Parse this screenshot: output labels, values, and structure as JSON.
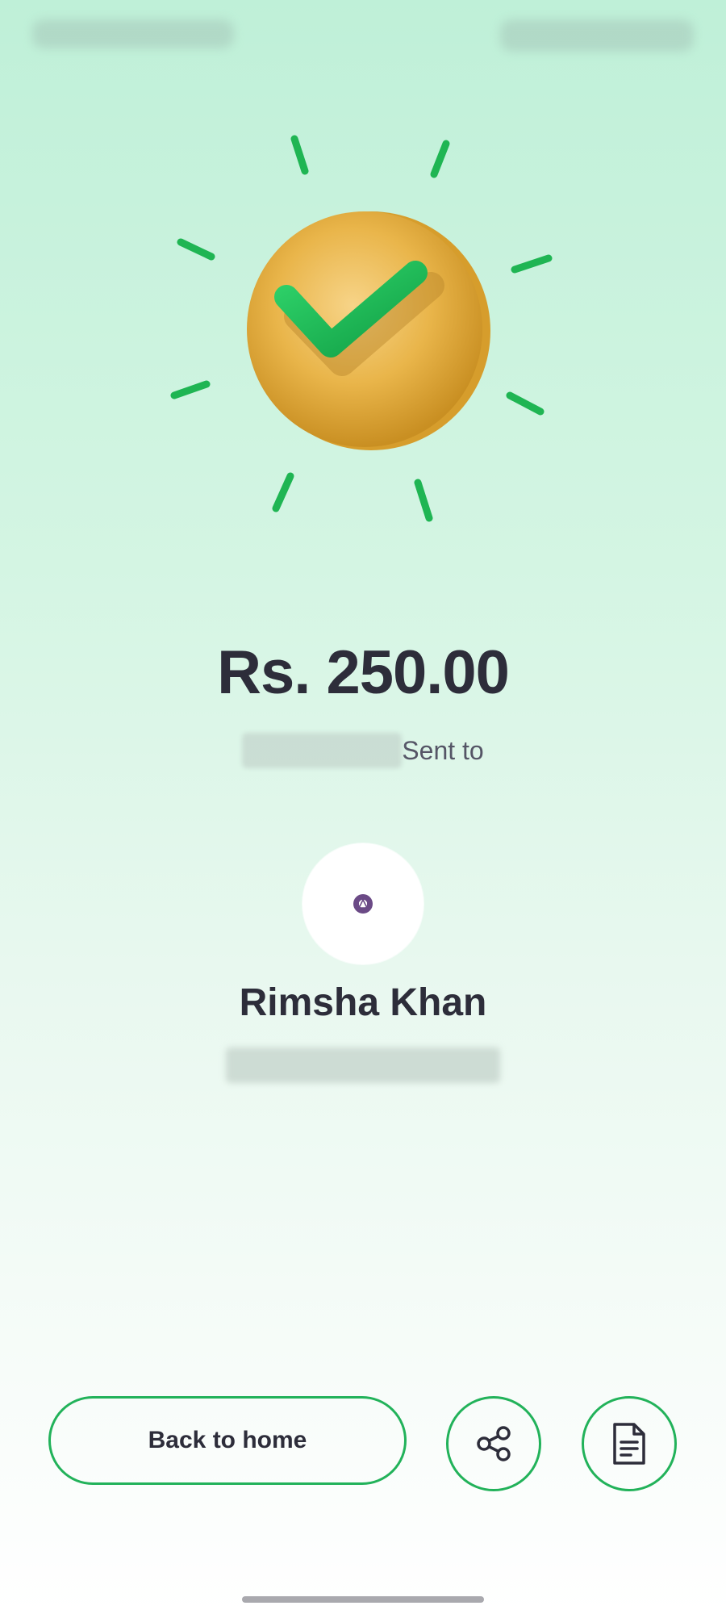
{
  "transaction": {
    "amount": "Rs. 250.00",
    "sent_label": "Sent to"
  },
  "recipient": {
    "name": "Rimsha Khan",
    "avatar_icon": "bank-logo-icon"
  },
  "actions": {
    "back_home_label": "Back to home",
    "share_icon": "share-icon",
    "receipt_icon": "receipt-icon"
  },
  "colors": {
    "accent": "#22b25a",
    "coin": "#e8b648",
    "text": "#2d2d3a"
  }
}
